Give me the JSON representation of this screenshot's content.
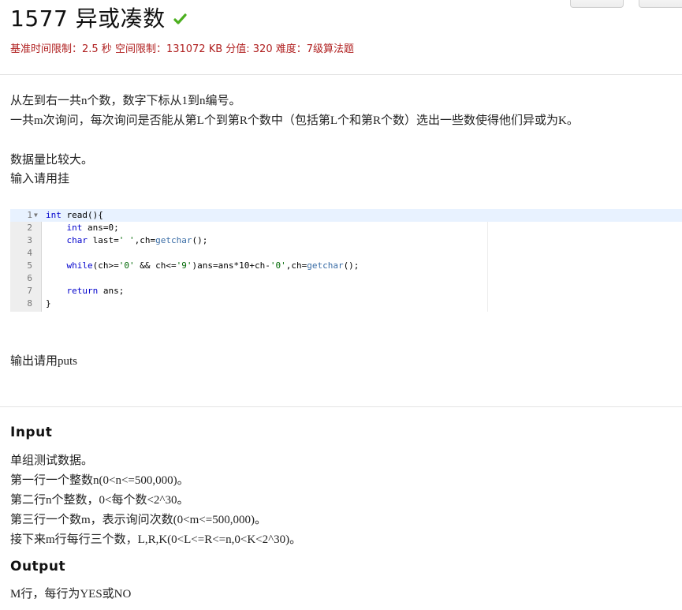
{
  "problem": {
    "title": "1577 异或凑数",
    "status_icon": "check-icon",
    "status_color": "#4caf1f",
    "meta": "基准时间限制：2.5 秒 空间限制：131072 KB 分值: 320 难度：7级算法题",
    "description": [
      "从左到右一共n个数，数字下标从1到n编号。",
      "一共m次询问，每次询问是否能从第L个到第R个数中（包括第L个和第R个数）选出一些数使得他们异或为K。",
      "数据量比较大。",
      "输入请用挂",
      "输出请用puts"
    ],
    "code_lines": [
      {
        "num": "1",
        "text": "int read(){"
      },
      {
        "num": "2",
        "text": "    int ans=0;"
      },
      {
        "num": "3",
        "text": "    char last=' ',ch=getchar();"
      },
      {
        "num": "4",
        "text": ""
      },
      {
        "num": "5",
        "text": "    while(ch>='0' && ch<='9')ans=ans*10+ch-'0',ch=getchar();"
      },
      {
        "num": "6",
        "text": ""
      },
      {
        "num": "7",
        "text": "    return ans;"
      },
      {
        "num": "8",
        "text": "}"
      }
    ],
    "input_heading": "Input",
    "input_lines": [
      "单组测试数据。",
      "第一行一个整数n(0<n<=500,000)。",
      "第二行n个整数，0<每个数<2^30。",
      "第三行一个数m，表示询问次数(0<m<=500,000)。",
      "接下来m行每行三个数，L,R,K(0<L<=R<=n,0<K<2^30)。"
    ],
    "output_heading": "Output",
    "output_lines": [
      "M行，每行为YES或NO"
    ]
  }
}
